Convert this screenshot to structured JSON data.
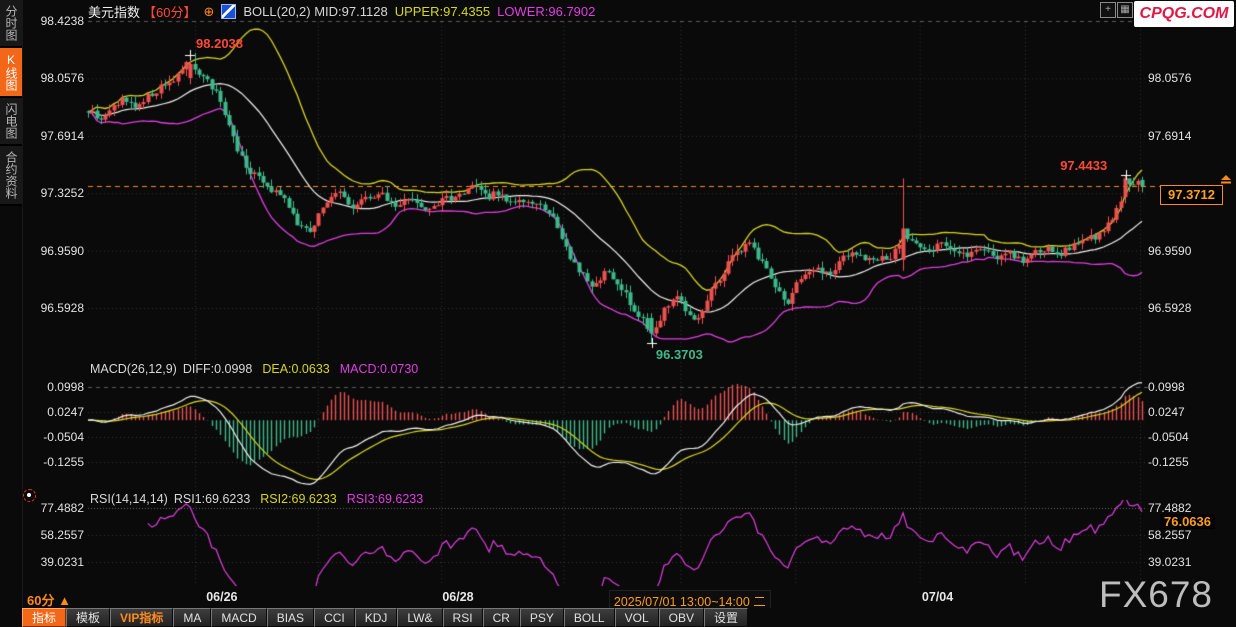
{
  "header": {
    "title": "美元指数",
    "period": "【60分】",
    "plus_icon": "⊕",
    "boll_label": "BOLL(20,2) MID:97.1128",
    "upper_label": "UPPER:97.4355",
    "lower_label": "LOWER:96.7902"
  },
  "logo": "CPQG.COM",
  "watermark": "FX678",
  "top_icons": {
    "pan": "+",
    "scale": "▦"
  },
  "sidebar": {
    "items": [
      {
        "label": "分时图",
        "active": false
      },
      {
        "label": "K线图",
        "active": true
      },
      {
        "label": "闪电图",
        "active": false
      },
      {
        "label": "合约资料",
        "active": false
      }
    ]
  },
  "price_tag": "97.3712",
  "rsi_tag": "76.0636",
  "statusbar": {
    "period": "60分",
    "arrow": "▲"
  },
  "toolbar": {
    "items": [
      {
        "label": "指标",
        "active": true,
        "vip": false
      },
      {
        "label": "模板",
        "active": false,
        "vip": false
      },
      {
        "label": "VIP指标",
        "active": false,
        "vip": true
      },
      {
        "label": "MA",
        "active": false,
        "vip": false
      },
      {
        "label": "MACD",
        "active": false,
        "vip": false
      },
      {
        "label": "BIAS",
        "active": false,
        "vip": false
      },
      {
        "label": "CCI",
        "active": false,
        "vip": false
      },
      {
        "label": "KDJ",
        "active": false,
        "vip": false
      },
      {
        "label": "LW&",
        "active": false,
        "vip": false
      },
      {
        "label": "RSI",
        "active": false,
        "vip": false
      },
      {
        "label": "CR",
        "active": false,
        "vip": false
      },
      {
        "label": "PSY",
        "active": false,
        "vip": false
      },
      {
        "label": "BOLL",
        "active": false,
        "vip": false
      },
      {
        "label": "VOL",
        "active": false,
        "vip": false
      },
      {
        "label": "OBV",
        "active": false,
        "vip": false
      },
      {
        "label": "设置",
        "active": false,
        "vip": false
      }
    ]
  },
  "colors": {
    "up": "#ef5151",
    "down": "#3db98b",
    "boll_upper": "#d6d61f",
    "boll_mid": "#f0f0f0",
    "boll_lower": "#e03ee0",
    "macd_diff": "#f0f0f0",
    "macd_dea": "#d6d61f",
    "rsi_line": "#e03ee0",
    "price_line": "#ff8a1a",
    "accent": "#f26718",
    "annotation_up": "#ff4836",
    "annotation_down": "#3db98b",
    "grid": "#343434",
    "grid_bright": "#5c5c5c"
  },
  "chart_data": {
    "type": "candlestick",
    "symbol": "美元指数",
    "interval": "60min",
    "main": {
      "y_ticks_left": [
        "98.4238",
        "98.0576",
        "97.6914",
        "97.3252",
        "96.9590",
        "96.5928"
      ],
      "y_ticks_right": [
        "98.0576",
        "97.6914",
        "96.9590",
        "96.5928"
      ],
      "last_price": 97.3712,
      "boll": {
        "mid": 97.1128,
        "upper": 97.4355,
        "lower": 96.7902
      },
      "annotations": [
        {
          "text": "98.2038",
          "frac": 0.0968,
          "price": 98.2038,
          "kind": "high",
          "side": "right"
        },
        {
          "text": "96.3703",
          "frac": 0.535,
          "price": 96.3703,
          "kind": "low",
          "side": "below"
        },
        {
          "text": "97.4433",
          "frac": 0.985,
          "price": 97.4433,
          "kind": "high",
          "side": "left"
        }
      ],
      "candle_count": 248,
      "close_path": [
        [
          0.0,
          97.86
        ],
        [
          0.012,
          97.8
        ],
        [
          0.03,
          97.92
        ],
        [
          0.045,
          97.88
        ],
        [
          0.06,
          97.96
        ],
        [
          0.075,
          98.02
        ],
        [
          0.088,
          98.1
        ],
        [
          0.097,
          98.17
        ],
        [
          0.105,
          98.1
        ],
        [
          0.115,
          98.02
        ],
        [
          0.125,
          97.92
        ],
        [
          0.14,
          97.62
        ],
        [
          0.155,
          97.45
        ],
        [
          0.17,
          97.37
        ],
        [
          0.185,
          97.3
        ],
        [
          0.2,
          97.12
        ],
        [
          0.212,
          97.08
        ],
        [
          0.225,
          97.28
        ],
        [
          0.237,
          97.33
        ],
        [
          0.25,
          97.22
        ],
        [
          0.263,
          97.28
        ],
        [
          0.275,
          97.33
        ],
        [
          0.29,
          97.25
        ],
        [
          0.305,
          97.3
        ],
        [
          0.32,
          97.23
        ],
        [
          0.335,
          97.27
        ],
        [
          0.35,
          97.32
        ],
        [
          0.365,
          97.37
        ],
        [
          0.378,
          97.3
        ],
        [
          0.39,
          97.33
        ],
        [
          0.402,
          97.26
        ],
        [
          0.415,
          97.29
        ],
        [
          0.428,
          97.25
        ],
        [
          0.44,
          97.18
        ],
        [
          0.452,
          96.98
        ],
        [
          0.465,
          96.85
        ],
        [
          0.478,
          96.72
        ],
        [
          0.49,
          96.82
        ],
        [
          0.502,
          96.75
        ],
        [
          0.515,
          96.62
        ],
        [
          0.527,
          96.5
        ],
        [
          0.535,
          96.44
        ],
        [
          0.545,
          96.56
        ],
        [
          0.557,
          96.66
        ],
        [
          0.568,
          96.58
        ],
        [
          0.578,
          96.52
        ],
        [
          0.59,
          96.68
        ],
        [
          0.602,
          96.82
        ],
        [
          0.615,
          96.95
        ],
        [
          0.628,
          97.0
        ],
        [
          0.64,
          96.88
        ],
        [
          0.652,
          96.72
        ],
        [
          0.663,
          96.62
        ],
        [
          0.675,
          96.78
        ],
        [
          0.688,
          96.86
        ],
        [
          0.7,
          96.8
        ],
        [
          0.712,
          96.88
        ],
        [
          0.724,
          96.95
        ],
        [
          0.735,
          96.9
        ],
        [
          0.748,
          96.92
        ],
        [
          0.76,
          96.88
        ],
        [
          0.773,
          97.05
        ],
        [
          0.785,
          97.02
        ],
        [
          0.797,
          96.95
        ],
        [
          0.81,
          97.0
        ],
        [
          0.822,
          96.96
        ],
        [
          0.835,
          96.92
        ],
        [
          0.848,
          96.96
        ],
        [
          0.86,
          96.92
        ],
        [
          0.872,
          96.96
        ],
        [
          0.885,
          96.9
        ],
        [
          0.897,
          96.94
        ],
        [
          0.91,
          96.98
        ],
        [
          0.922,
          96.94
        ],
        [
          0.934,
          96.98
        ],
        [
          0.946,
          97.02
        ],
        [
          0.958,
          97.06
        ],
        [
          0.97,
          97.15
        ],
        [
          0.98,
          97.28
        ],
        [
          0.99,
          97.41
        ],
        [
          1.0,
          97.3712
        ]
      ]
    },
    "macd": {
      "label": "MACD(26,12,9)",
      "diff_label": "DIFF:0.0998",
      "dea_label": "DEA:0.0633",
      "macd_label": "MACD:0.0730",
      "diff": 0.0998,
      "dea": 0.0633,
      "macd": 0.073,
      "y_ticks": [
        "0.0998",
        "0.0247",
        "-0.0504",
        "-0.1255"
      ]
    },
    "rsi": {
      "label": "RSI(14,14,14)",
      "rsi1_label": "RSI1:69.6233",
      "rsi2_label": "RSI2:69.6233",
      "rsi3_label": "RSI3:69.6233",
      "rsi1": 69.6233,
      "rsi2": 69.6233,
      "rsi3": 69.6233,
      "y_ticks": [
        "77.4882",
        "58.2557",
        "39.0231"
      ],
      "last": 76.0636
    },
    "x_labels": [
      {
        "label": "06/26",
        "frac": 0.127,
        "highlight": false
      },
      {
        "label": "06/28",
        "frac": 0.351,
        "highlight": false
      },
      {
        "label": "2025/07/01 13:00~14:00 二",
        "frac": 0.571,
        "highlight": true
      },
      {
        "label": "07/04",
        "frac": 0.806,
        "highlight": false
      }
    ],
    "grid_fracs": [
      0.1015,
      0.218,
      0.335,
      0.451,
      0.562,
      0.671,
      0.789,
      0.889,
      0.998
    ]
  }
}
